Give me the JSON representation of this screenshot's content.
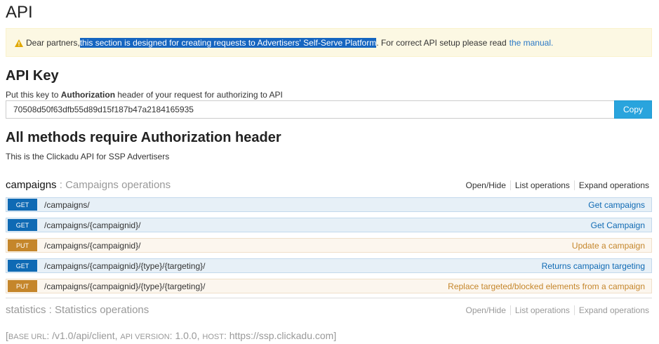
{
  "page": {
    "title": "API"
  },
  "notice": {
    "prefix": "Dear partners, ",
    "highlight": "this section is designed for creating requests to Advertisers' Self-Serve Platform",
    "suffix": ". For correct API setup please read",
    "link": "the manual."
  },
  "api_key": {
    "title": "API Key",
    "desc_before": "Put this key to ",
    "desc_bold": "Authorization",
    "desc_after": " header of your request for authorizing to API",
    "value": "70508d50f63dfb55d89d15f187b47a2184165935",
    "copy_label": "Copy"
  },
  "info": {
    "title": "All methods require Authorization header",
    "description": "This is the Clickadu API for SSP Advertisers"
  },
  "sections": [
    {
      "name": "campaigns",
      "separator": " : ",
      "description": "Campaigns operations",
      "ops": [
        "Open/Hide",
        "List operations",
        "Expand operations"
      ]
    },
    {
      "name": "statistics",
      "separator": " : ",
      "description": "Statistics operations",
      "ops": [
        "Open/Hide",
        "List operations",
        "Expand operations"
      ]
    }
  ],
  "endpoints": [
    {
      "method": "GET",
      "path": "/campaigns/",
      "summary": "Get campaigns"
    },
    {
      "method": "GET",
      "path": "/campaigns/{campaignid}/",
      "summary": "Get Campaign"
    },
    {
      "method": "PUT",
      "path": "/campaigns/{campaignid}/",
      "summary": "Update a campaign"
    },
    {
      "method": "GET",
      "path": "/campaigns/{campaignid}/{type}/{targeting}/",
      "summary": "Returns campaign targeting"
    },
    {
      "method": "PUT",
      "path": "/campaigns/{campaignid}/{type}/{targeting}/",
      "summary": "Replace targeted/blocked elements from a campaign"
    }
  ],
  "footer": {
    "open": "[",
    "base_url_label": "Base url",
    "base_url_value": "/v1.0/api/client",
    "api_version_label": "Api version",
    "api_version_value": "1.0.0",
    "host_label": "Host",
    "host_value": "https://ssp.clickadu.com",
    "close": "]"
  },
  "colors": {
    "get": "#0f6ab4",
    "put": "#c5862b",
    "copy_button": "#29a4dd",
    "notice_bg": "#fcf8e3",
    "selection": "#1565c0"
  }
}
